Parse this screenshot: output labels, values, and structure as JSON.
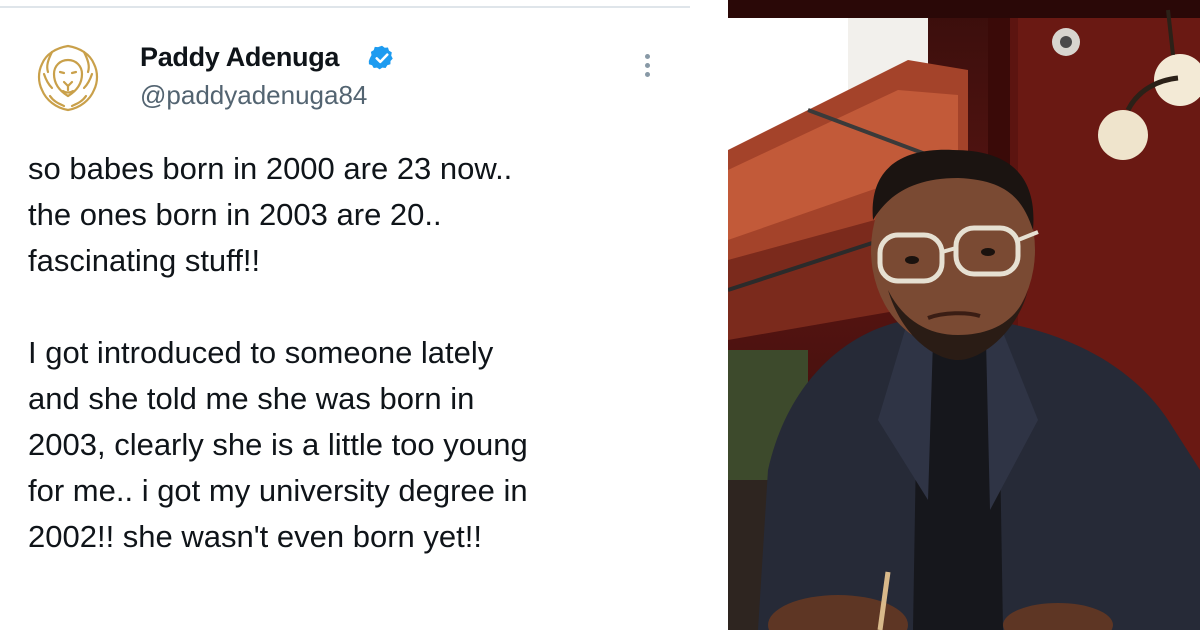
{
  "tweet": {
    "author_name": "Paddy Adenuga",
    "author_handle": "@paddyadenuga84",
    "verified": true,
    "paragraph1": [
      "so babes born in 2000 are 23 now..",
      "the ones born in 2003 are 20..",
      "fascinating stuff!!"
    ],
    "paragraph2": [
      "I got introduced to someone lately",
      "and she told me she was born in",
      "2003, clearly she is a little too young",
      "for me.. i got my university degree in",
      "2002!! she wasn't even born yet!!"
    ]
  },
  "icons": {
    "avatar": "gold-lion-logo",
    "verified": "verified-badge-icon",
    "more": "more-options-icon"
  },
  "colors": {
    "text": "#0f1419",
    "handle": "#536471",
    "verified": "#1d9bf0",
    "logo_gold": "#c9a04a"
  }
}
